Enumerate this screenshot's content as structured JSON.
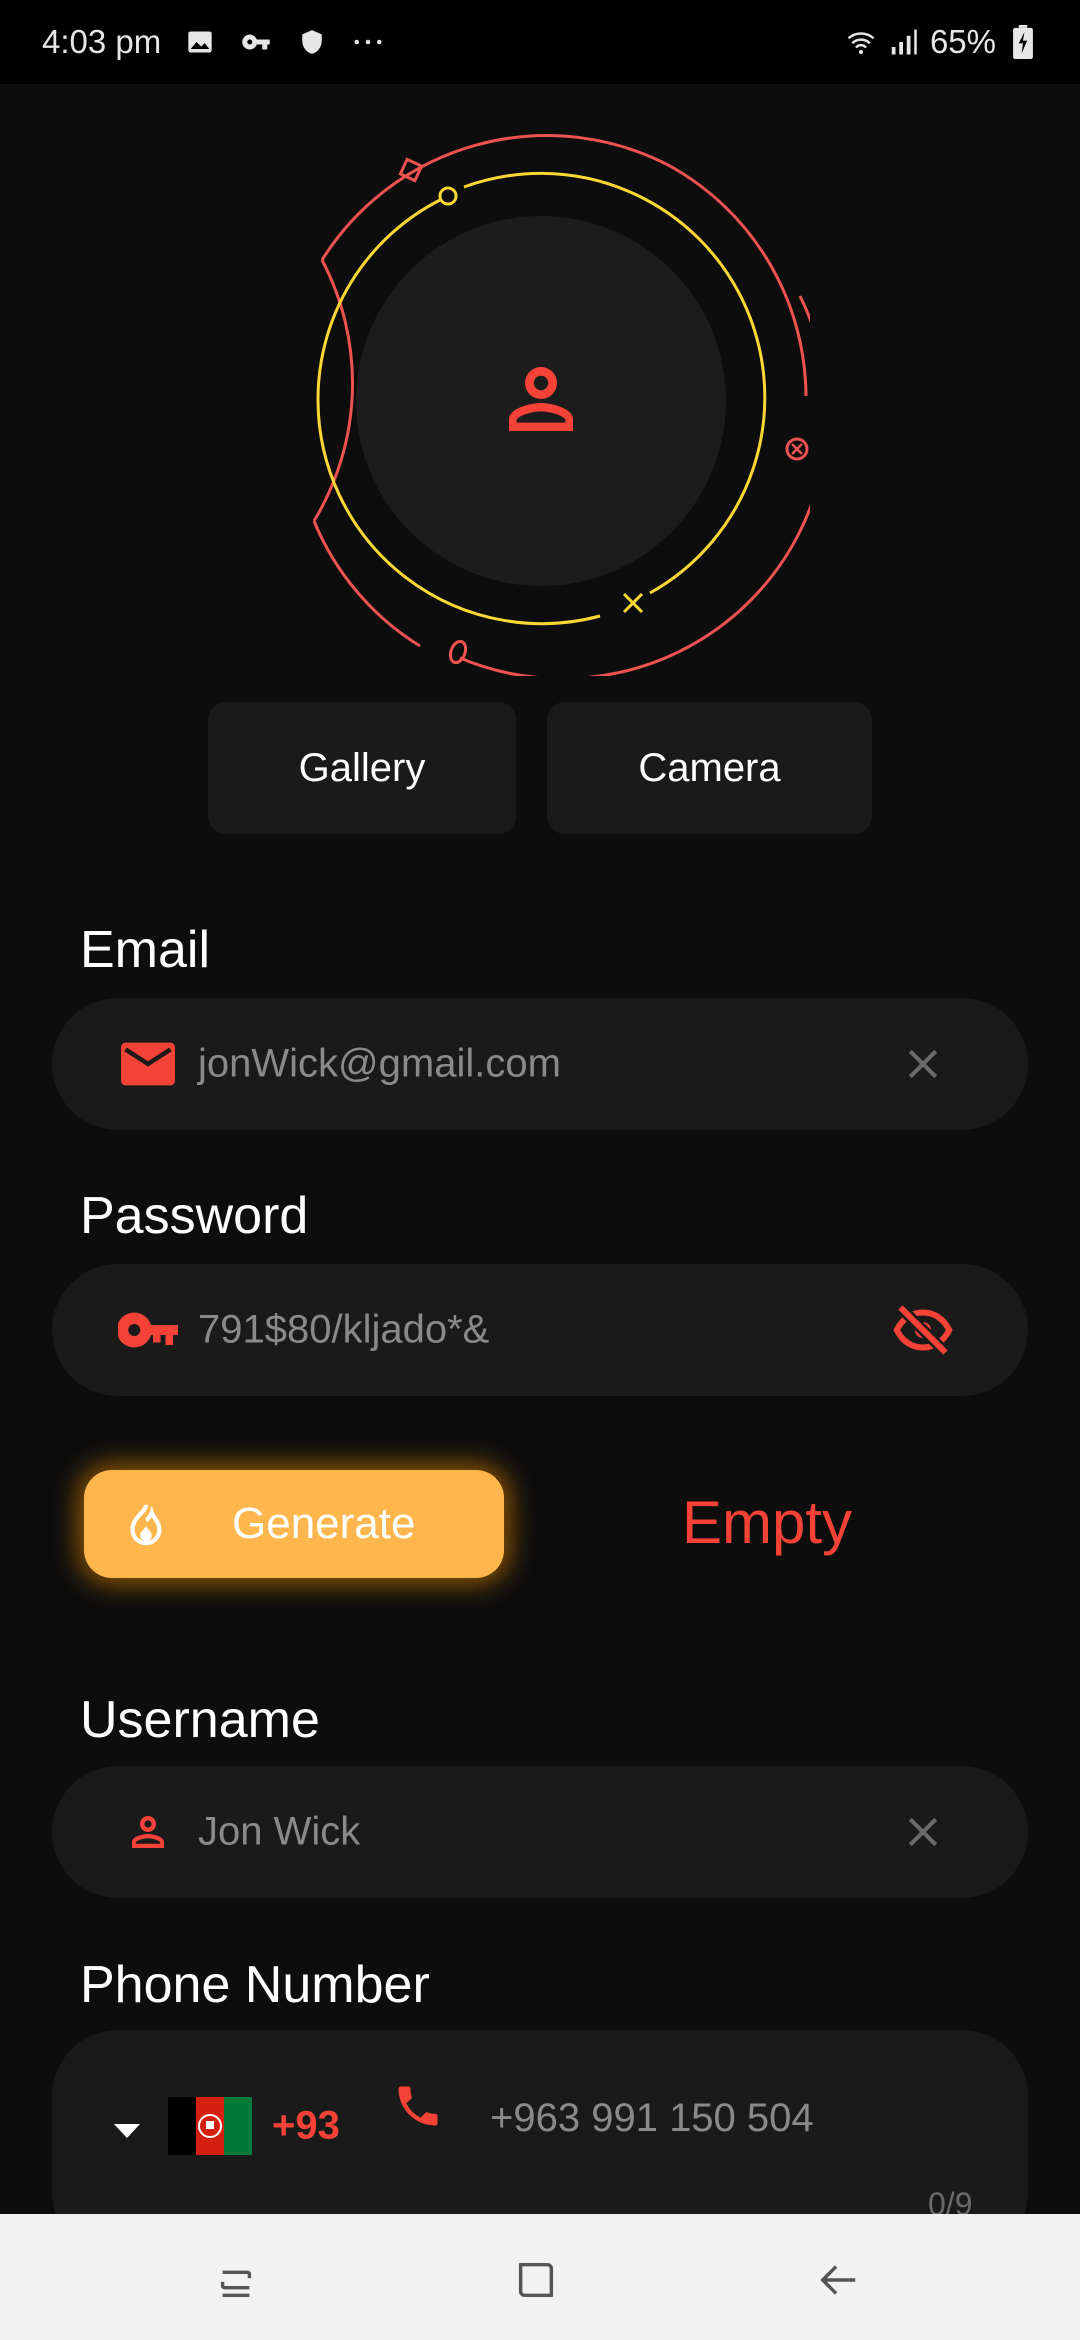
{
  "status_bar": {
    "time": "4:03 pm",
    "battery": "65%",
    "icons": [
      "image-icon",
      "key-icon",
      "shield-icon",
      "more-icon",
      "wifi-icon",
      "signal-icon",
      "battery-icon"
    ]
  },
  "avatar": {
    "icon": "person-icon",
    "ring_colors": {
      "outer": "#ef5350",
      "inner": "#fdd835"
    }
  },
  "image_source": {
    "gallery_label": "Gallery",
    "camera_label": "Camera"
  },
  "email": {
    "label": "Email",
    "value": "jonWick@gmail.com",
    "lead_icon": "mail-icon",
    "trail_icon": "clear-icon"
  },
  "password": {
    "label": "Password",
    "value": "791$80/kljado*&",
    "lead_icon": "key-icon",
    "trail_icon": "visibility-off-icon"
  },
  "generate": {
    "label": "Generate",
    "icon": "fire-icon",
    "strength": "Empty"
  },
  "username": {
    "label": "Username",
    "value": "Jon Wick",
    "lead_icon": "person-icon",
    "trail_icon": "clear-icon"
  },
  "phone": {
    "label": "Phone Number",
    "dial_code": "+93",
    "value": "+963 991 150 504",
    "counter": "0/9",
    "country_flag": "Afghanistan"
  },
  "colors": {
    "accent": "#f44336",
    "generate": "#ffb74d",
    "field_bg": "#1a1a1a",
    "background": "#0d0d0d"
  },
  "nav_bar": {
    "icons": [
      "recent-apps-icon",
      "home-icon",
      "back-icon"
    ]
  }
}
